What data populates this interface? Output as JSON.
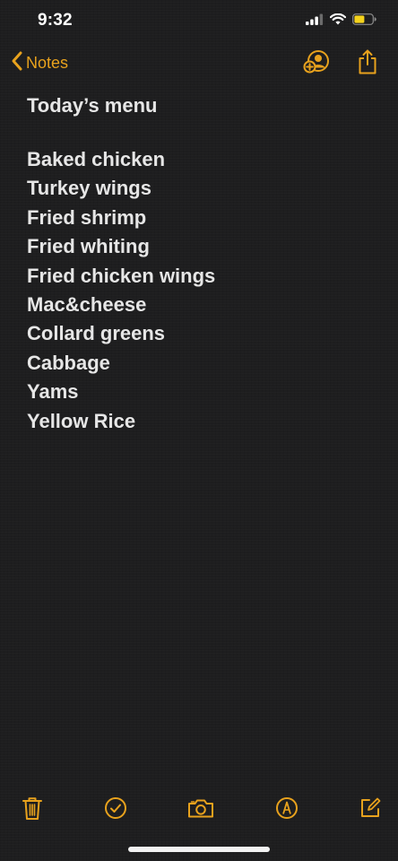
{
  "status_bar": {
    "time": "9:32"
  },
  "nav": {
    "back_label": "Notes",
    "accent_color": "#e8a21d",
    "icons": [
      "chevron-left-icon",
      "add-person-icon",
      "share-icon"
    ]
  },
  "note": {
    "title": "Today’s menu",
    "items": [
      "Baked chicken",
      "Turkey wings",
      "Fried shrimp",
      "Fried whiting",
      "Fried chicken wings",
      "Mac&cheese",
      "Collard greens",
      "Cabbage",
      "Yams",
      "Yellow Rice"
    ]
  },
  "toolbar": {
    "icons": [
      "trash-icon",
      "checklist-icon",
      "camera-icon",
      "markup-icon",
      "compose-icon"
    ]
  }
}
